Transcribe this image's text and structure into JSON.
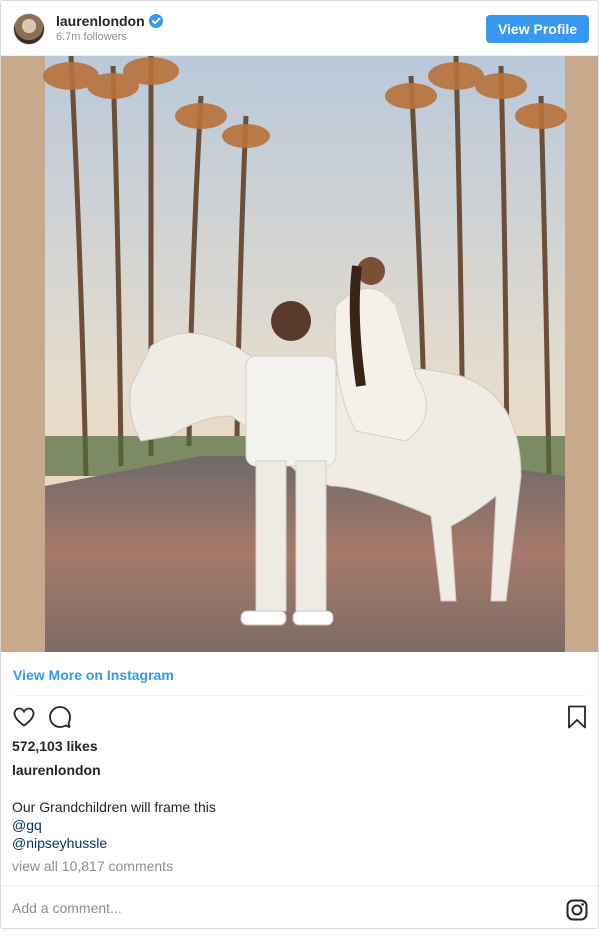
{
  "header": {
    "username": "laurenlondon",
    "followers": "6.7m followers",
    "view_profile_label": "View Profile"
  },
  "post": {
    "view_more_label": "View More on Instagram",
    "likes": "572,103 likes",
    "owner": "laurenlondon",
    "caption": "Our Grandchildren will frame this",
    "mentions": [
      "@gq",
      "@nipseyhussle"
    ],
    "comments_link": "view all 10,817 comments"
  },
  "footer": {
    "add_comment_placeholder": "Add a comment..."
  },
  "colors": {
    "accent": "#3897f0",
    "mention": "#003569",
    "muted": "#8e8e8e"
  },
  "icons": [
    "verified-badge-icon",
    "heart-icon",
    "comment-icon",
    "bookmark-icon",
    "instagram-logo-icon"
  ]
}
